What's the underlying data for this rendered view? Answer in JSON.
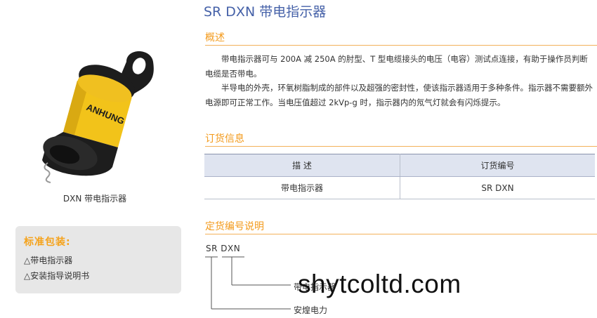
{
  "left": {
    "product_caption": "DXN 带电指示器",
    "packing": {
      "title": "标准包装:",
      "items": [
        "△带电指示器",
        "△安装指导说明书"
      ]
    },
    "photo": {
      "brand_text": "ANHUNG",
      "colors": {
        "body": "#f2c31a",
        "cap": "#1d1d1d"
      }
    }
  },
  "header": {
    "title": "SR DXN 带电指示器"
  },
  "overview": {
    "title": "概述",
    "paragraphs": [
      "带电指示器可与 200A 减 250A 的肘型、T 型电缆接头的电压（电容）测试点连接，有助于操作员判断电缆是否带电。",
      "半导电的外壳，环氧树脂制成的部件以及超强的密封性，使该指示器适用于多种条件。指示器不需要额外电源即可正常工作。当电压值超过 2kVp-g 时，指示器内的氖气灯就会有闪烁提示。"
    ]
  },
  "ordering": {
    "title": "订货信息",
    "headers": [
      "描 述",
      "订货编号"
    ],
    "rows": [
      [
        "带电指示器",
        "SR DXN"
      ]
    ]
  },
  "code_explain": {
    "title": "定货编号说明",
    "code": "SR DXN",
    "labels": [
      "带电指示器",
      "安煌电力"
    ]
  },
  "watermark": "shytcoltd.com",
  "colors": {
    "title_blue": "#4561a8",
    "accent_orange": "#f39a1b",
    "table_header": "#dfe4f0",
    "packing_bg": "#e7e7e7"
  }
}
